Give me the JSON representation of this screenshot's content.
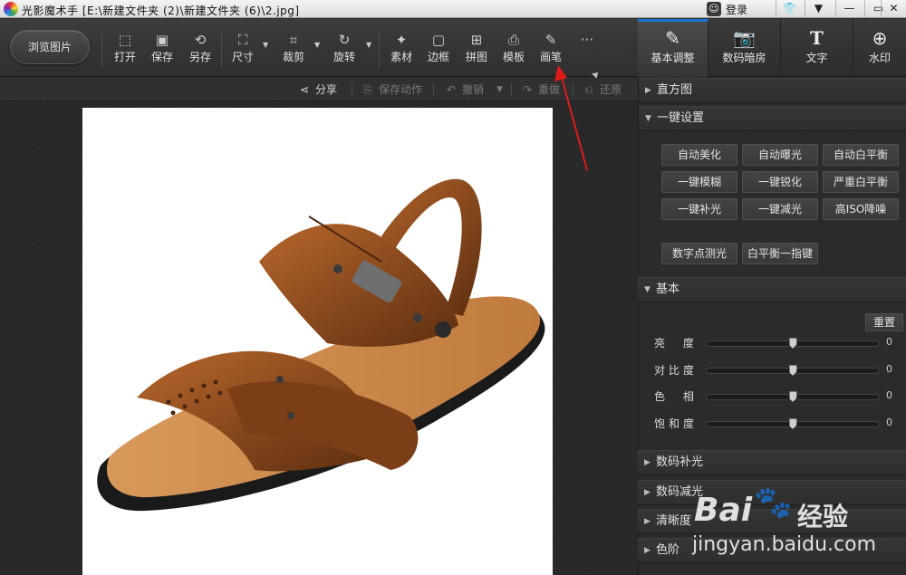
{
  "titlebar": {
    "title": "光影魔术手 [E:\\新建文件夹 (2)\\新建文件夹 (6)\\2.jpg]",
    "login_label": "登录",
    "buttons": [
      "👕",
      "▼",
      "—",
      "▭",
      "✕"
    ]
  },
  "toolbar": {
    "browse_label": "浏览图片",
    "tools": [
      {
        "label": "打开",
        "icon": "open-icon",
        "glyph": "⬚"
      },
      {
        "label": "保存",
        "icon": "save-icon",
        "glyph": "▣"
      },
      {
        "label": "另存",
        "icon": "save-as-icon",
        "glyph": "⟲"
      },
      {
        "label": "尺寸",
        "icon": "size-icon",
        "glyph": "⛶"
      },
      {
        "label": "裁剪",
        "icon": "crop-icon",
        "glyph": "⌗"
      },
      {
        "label": "旋转",
        "icon": "rotate-icon",
        "glyph": "↻"
      },
      {
        "label": "素材",
        "icon": "material-icon",
        "glyph": "✦"
      },
      {
        "label": "边框",
        "icon": "frame-icon",
        "glyph": "▢"
      },
      {
        "label": "拼图",
        "icon": "puzzle-icon",
        "glyph": "⊞"
      },
      {
        "label": "模板",
        "icon": "template-icon",
        "glyph": "⎙"
      },
      {
        "label": "画笔",
        "icon": "brush-icon",
        "glyph": "✎"
      },
      {
        "label": "",
        "icon": "more-icon",
        "glyph": "···"
      }
    ]
  },
  "right_tabs": [
    {
      "label": "基本调整",
      "icon": "basic-adjust-icon",
      "glyph": "✎",
      "active": true
    },
    {
      "label": "数码暗房",
      "icon": "darkroom-icon",
      "glyph": "📷",
      "active": false
    },
    {
      "label": "文字",
      "icon": "text-icon",
      "glyph": "T",
      "active": false
    },
    {
      "label": "水印",
      "icon": "watermark-icon",
      "glyph": "⊕",
      "active": false
    }
  ],
  "actions": [
    {
      "label": "分享",
      "icon": "share-icon",
      "glyph": "⋖",
      "enabled": true
    },
    {
      "label": "保存动作",
      "icon": "save-action-icon",
      "glyph": "⎘",
      "enabled": false
    },
    {
      "label": "撤销",
      "icon": "undo-icon",
      "glyph": "↶",
      "enabled": false
    },
    {
      "label": "重做",
      "icon": "redo-icon",
      "glyph": "↷",
      "enabled": false
    },
    {
      "label": "还原",
      "icon": "restore-icon",
      "glyph": "⎌",
      "enabled": false
    }
  ],
  "panel": {
    "histogram": "直方图",
    "oneclick": "一键设置",
    "oneclick_buttons": [
      [
        "自动美化",
        "自动曝光",
        "自动白平衡"
      ],
      [
        "一键模糊",
        "一键锐化",
        "严重白平衡"
      ],
      [
        "一键补光",
        "一键减光",
        "高ISO降噪"
      ]
    ],
    "extra_buttons": [
      "数字点测光",
      "白平衡一指键"
    ],
    "basic": "基本",
    "reset": "重置",
    "sliders": [
      {
        "label": "亮 度",
        "value": "0",
        "level": 0.5
      },
      {
        "label": "对比度",
        "value": "0",
        "level": 0.5
      },
      {
        "label": "色 相",
        "value": "0",
        "level": 0.5
      },
      {
        "label": "饱和度",
        "value": "0",
        "level": 0.5
      }
    ],
    "collapsed": [
      "数码补光",
      "数码减光",
      "清晰度",
      "色阶"
    ]
  },
  "watermark": {
    "brand": "Bai",
    "cn": "经验",
    "url": "jingyan.baidu.com"
  },
  "colors": {
    "accent": "#1976d2",
    "arrow": "#e01b1b",
    "leather": "#8a4a1e",
    "sole": "#c8864a"
  }
}
